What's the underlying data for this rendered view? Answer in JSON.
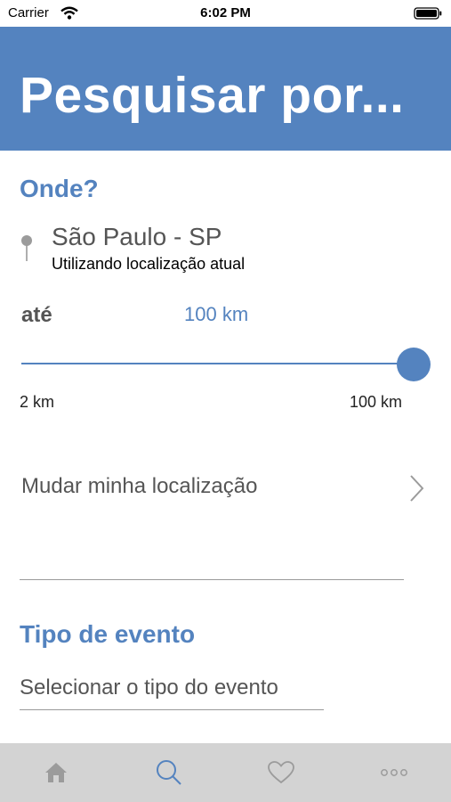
{
  "status_bar": {
    "carrier": "Carrier",
    "time": "6:02 PM",
    "icons": [
      "wifi-icon",
      "battery-icon"
    ]
  },
  "header": {
    "title": "Pesquisar por..."
  },
  "location": {
    "heading": "Onde?",
    "city": "São Paulo - SP",
    "source_text": "Utilizando localização atual",
    "distance_prefix": "até",
    "distance_value": "100 km",
    "slider": {
      "min_label": "2 km",
      "max_label": "100 km",
      "value_km": 100,
      "min_km": 2,
      "max_km": 100
    },
    "change_label": "Mudar minha localização"
  },
  "event_type": {
    "heading": "Tipo de evento",
    "select_label": "Selecionar o tipo do evento"
  },
  "tab_bar": {
    "items": [
      {
        "icon": "home-icon",
        "active": false
      },
      {
        "icon": "search-icon",
        "active": true
      },
      {
        "icon": "heart-icon",
        "active": false
      },
      {
        "icon": "more-icon",
        "active": false
      }
    ]
  },
  "colors": {
    "accent": "#5483bf",
    "tab_bar_bg": "#d3d3d3",
    "tab_icon_inactive": "#9b9b9b"
  }
}
